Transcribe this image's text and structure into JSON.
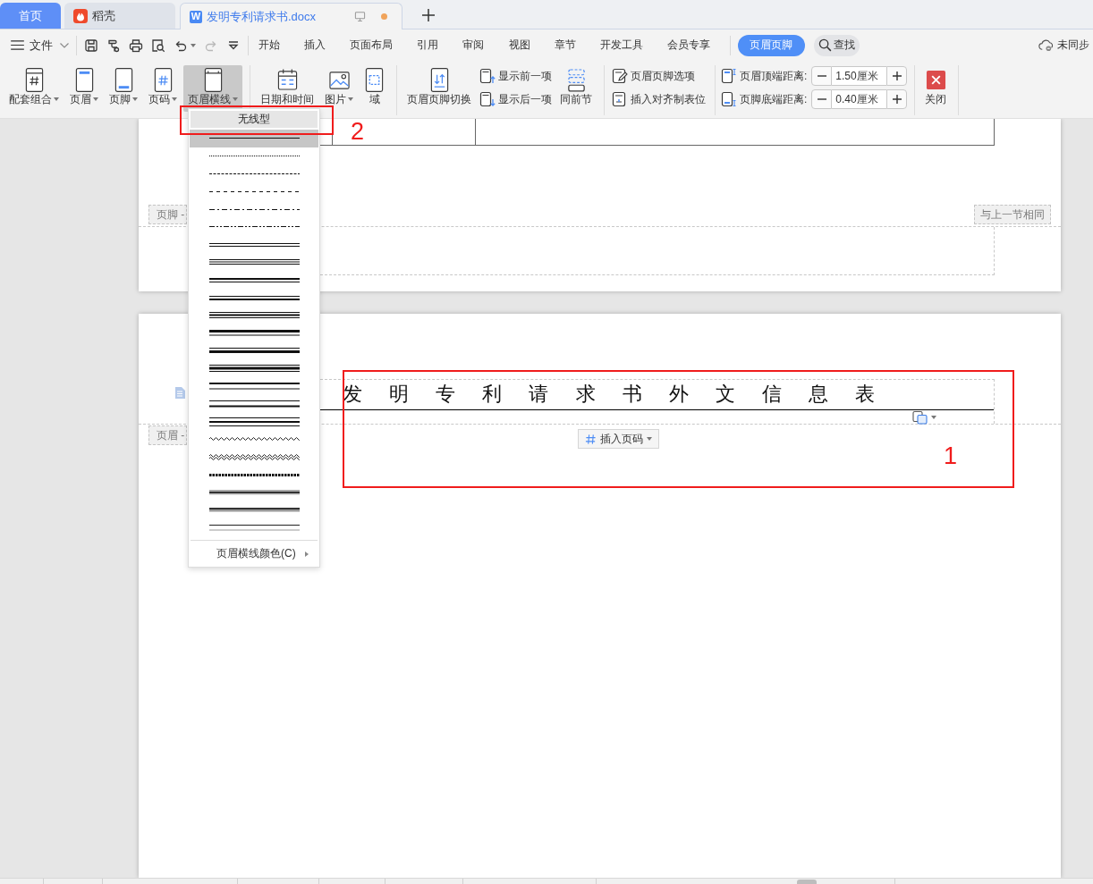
{
  "tabs": [
    {
      "label": "首页",
      "kind": "home",
      "selected": false,
      "unsaved": false
    },
    {
      "label": "稻壳",
      "kind": "docer",
      "selected": false,
      "unsaved": false
    },
    {
      "label": "发明专利请求书.docx",
      "kind": "document",
      "logo": "W",
      "selected": true,
      "unsaved": true
    }
  ],
  "file_menu": {
    "label": "文件"
  },
  "quick_tools": [
    {
      "kind": "save",
      "disabled": false,
      "dropdown": false
    },
    {
      "kind": "painter",
      "disabled": false,
      "dropdown": false
    },
    {
      "kind": "print",
      "disabled": false,
      "dropdown": false
    },
    {
      "kind": "preview",
      "disabled": false,
      "dropdown": false
    },
    {
      "kind": "undo",
      "disabled": false,
      "dropdown": true
    },
    {
      "kind": "redo",
      "disabled": true,
      "dropdown": false
    },
    {
      "kind": "customize",
      "disabled": false,
      "dropdown": false
    }
  ],
  "menu_tabs": [
    {
      "label": "开始",
      "kind": "standard",
      "selected": false
    },
    {
      "label": "插入",
      "kind": "standard",
      "selected": false
    },
    {
      "label": "页面布局",
      "kind": "standard",
      "selected": false
    },
    {
      "label": "引用",
      "kind": "standard",
      "selected": false
    },
    {
      "label": "审阅",
      "kind": "standard",
      "selected": false
    },
    {
      "label": "视图",
      "kind": "standard",
      "selected": false
    },
    {
      "label": "章节",
      "kind": "standard",
      "selected": false
    },
    {
      "label": "开发工具",
      "kind": "standard",
      "selected": false
    },
    {
      "label": "会员专享",
      "kind": "standard",
      "selected": false
    },
    {
      "label": "页眉页脚",
      "kind": "contextual",
      "selected": true
    }
  ],
  "search": {
    "label": "查找"
  },
  "sync_status": {
    "label": "未同步"
  },
  "ribbon": {
    "groups": [
      {
        "columns": [
          [
            {
              "kind": "combo",
              "label": "配套组合",
              "dropdown": true,
              "pressed": false
            }
          ],
          [
            {
              "kind": "header",
              "label": "页眉",
              "dropdown": true,
              "pressed": false
            }
          ],
          [
            {
              "kind": "footer",
              "label": "页脚",
              "dropdown": true,
              "pressed": false
            }
          ],
          [
            {
              "kind": "pagenum",
              "label": "页码",
              "dropdown": true,
              "pressed": false
            }
          ],
          [
            {
              "kind": "headerline",
              "label": "页眉横线",
              "dropdown": true,
              "pressed": true
            }
          ]
        ]
      },
      {
        "columns": [
          [
            {
              "kind": "datetime",
              "label": "日期和时间",
              "dropdown": false,
              "pressed": false
            }
          ],
          [
            {
              "kind": "picture",
              "label": "图片",
              "dropdown": true,
              "pressed": false
            }
          ],
          [
            {
              "kind": "field",
              "label": "域",
              "dropdown": false,
              "pressed": false
            }
          ]
        ]
      },
      {
        "columns": [
          [
            {
              "kind": "switch",
              "label": "页眉页脚切换",
              "dropdown": false,
              "pressed": false
            }
          ],
          [
            {
              "kind": "prev",
              "label": "显示前一项",
              "dropdown": false,
              "pressed": false
            },
            {
              "kind": "next",
              "label": "显示后一项",
              "dropdown": false,
              "pressed": false
            }
          ],
          [
            {
              "kind": "sameprev",
              "label": "同前节",
              "dropdown": false,
              "pressed": false
            }
          ]
        ]
      },
      {
        "columns": [
          [
            {
              "kind": "options",
              "label": "页眉页脚选项",
              "dropdown": false,
              "pressed": false
            },
            {
              "kind": "tabstop",
              "label": "插入对齐制表位",
              "dropdown": false,
              "pressed": false
            }
          ]
        ]
      },
      {
        "columns": [
          [
            {
              "kind": "top",
              "label": "页眉顶端距离:",
              "value": "1.50厘米"
            },
            {
              "kind": "bottom",
              "label": "页脚底端距离:",
              "value": "0.40厘米"
            }
          ]
        ]
      },
      {
        "columns": [
          [
            {
              "kind": "close",
              "label": "关闭",
              "dropdown": false,
              "pressed": false
            }
          ]
        ]
      }
    ]
  },
  "document": {
    "previous_page": {
      "footer_label": "页脚 -",
      "link_label": "与上一节相同"
    },
    "current_page": {
      "header_text": "发 明 专 利 请 求 书 外 文 信 息 表",
      "header_label": "页眉 -",
      "insert_page_number": {
        "label": "插入页码",
        "dropdown": true
      }
    }
  },
  "header_line_menu": {
    "none_option": {
      "label": "无线型",
      "selected": false
    },
    "styles": [
      {
        "kind": "single",
        "selected": true
      },
      {
        "kind": "dotted",
        "selected": false
      },
      {
        "kind": "dash-small",
        "selected": false
      },
      {
        "kind": "dash-large",
        "selected": false
      },
      {
        "kind": "dash-dot",
        "selected": false
      },
      {
        "kind": "dash-dot-dot",
        "selected": false
      },
      {
        "kind": "double",
        "selected": false
      },
      {
        "kind": "triple",
        "selected": false
      },
      {
        "kind": "thick-thin-small",
        "selected": false
      },
      {
        "kind": "thin-thick-small",
        "selected": false
      },
      {
        "kind": "thin-thick-thin-small",
        "selected": false
      },
      {
        "kind": "thick-thin-medium",
        "selected": false
      },
      {
        "kind": "thin-thick-medium",
        "selected": false
      },
      {
        "kind": "thin-thick-thin-medium",
        "selected": false
      },
      {
        "kind": "thick-thin-large",
        "selected": false
      },
      {
        "kind": "thin-thick-large",
        "selected": false
      },
      {
        "kind": "thin-thick-thin-large",
        "selected": false
      },
      {
        "kind": "wave",
        "selected": false
      },
      {
        "kind": "double-wave",
        "selected": false
      },
      {
        "kind": "dash-dot-stroked",
        "selected": false
      },
      {
        "kind": "emboss",
        "selected": false
      },
      {
        "kind": "engrave",
        "selected": false
      },
      {
        "kind": "outset",
        "selected": false
      }
    ],
    "color_option": "页眉横线颜色(C)"
  },
  "annotations": [
    {
      "number": "1"
    },
    {
      "number": "2"
    }
  ]
}
